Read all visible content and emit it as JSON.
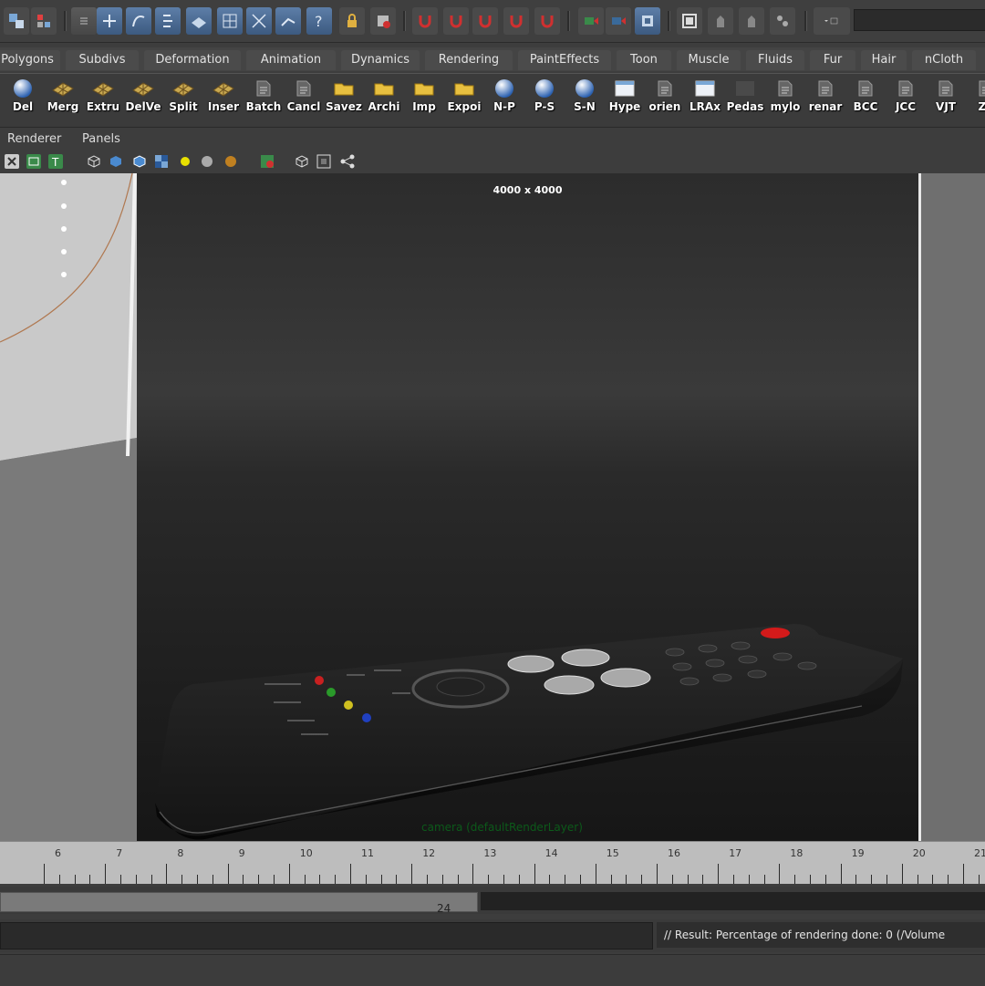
{
  "status_line": {
    "tools": [
      "select-by-hierarchy",
      "select-by-component",
      "snap-to-grid",
      "snap-to-curve",
      "snap-to-point",
      "snap-to-plane",
      "make-live",
      "help",
      "lock",
      "render-current",
      "render-ipr",
      "render-settings",
      "hypershade",
      "magnet",
      "show-attribute-editor",
      "toggle-channel-box",
      "toggle-tool-settings",
      "graph"
    ]
  },
  "shelf_tabs": [
    "Polygons",
    "Subdivs",
    "Deformation",
    "Animation",
    "Dynamics",
    "Rendering",
    "PaintEffects",
    "Toon",
    "Muscle",
    "Fluids",
    "Fur",
    "Hair",
    "nCloth"
  ],
  "shelf_buttons": [
    {
      "label": "Del",
      "icon": "sphere-icon"
    },
    {
      "label": "Merg",
      "icon": "mesh-icon"
    },
    {
      "label": "Extru",
      "icon": "mesh-icon"
    },
    {
      "label": "DelVe",
      "icon": "mesh-icon"
    },
    {
      "label": "Split",
      "icon": "mesh-icon"
    },
    {
      "label": "Inser",
      "icon": "mesh-icon"
    },
    {
      "label": "Batch",
      "icon": "script-icon"
    },
    {
      "label": "Cancl",
      "icon": "script-icon"
    },
    {
      "label": "Savez",
      "icon": "folder-icon"
    },
    {
      "label": "Archi",
      "icon": "folder-icon"
    },
    {
      "label": "Imp",
      "icon": "folder-icon"
    },
    {
      "label": "Expoi",
      "icon": "folder-icon"
    },
    {
      "label": "N-P",
      "icon": "sphere-icon"
    },
    {
      "label": "P-S",
      "icon": "sphere-icon"
    },
    {
      "label": "S-N",
      "icon": "sphere-icon"
    },
    {
      "label": "Hype",
      "icon": "window-icon"
    },
    {
      "label": "orien",
      "icon": "script-icon"
    },
    {
      "label": "LRAx",
      "icon": "window-icon"
    },
    {
      "label": "Pedas",
      "icon": "blank-icon"
    },
    {
      "label": "mylo",
      "icon": "script-icon"
    },
    {
      "label": "renar",
      "icon": "script-icon"
    },
    {
      "label": "BCC",
      "icon": "script-icon"
    },
    {
      "label": "JCC",
      "icon": "script-icon"
    },
    {
      "label": "VJT",
      "icon": "script-icon"
    },
    {
      "label": "Zo",
      "icon": "script-icon"
    }
  ],
  "panel_menu": {
    "renderer": "Renderer",
    "panels": "Panels"
  },
  "viewport": {
    "resolution": "4000 x 4000",
    "camera_label": "camera (defaultRenderLayer)"
  },
  "time_slider": {
    "frames": [
      6,
      7,
      8,
      9,
      10,
      11,
      12,
      13,
      14,
      15,
      16,
      17,
      18,
      19,
      20,
      21
    ]
  },
  "range_slider": {
    "end": "24"
  },
  "command_line": {
    "result": "// Result: Percentage of rendering done: 0 (/Volume"
  },
  "colors": {
    "accent": "#5d7ea8",
    "viewport_bg": "#252525",
    "remote_red": "#d31a1a"
  }
}
